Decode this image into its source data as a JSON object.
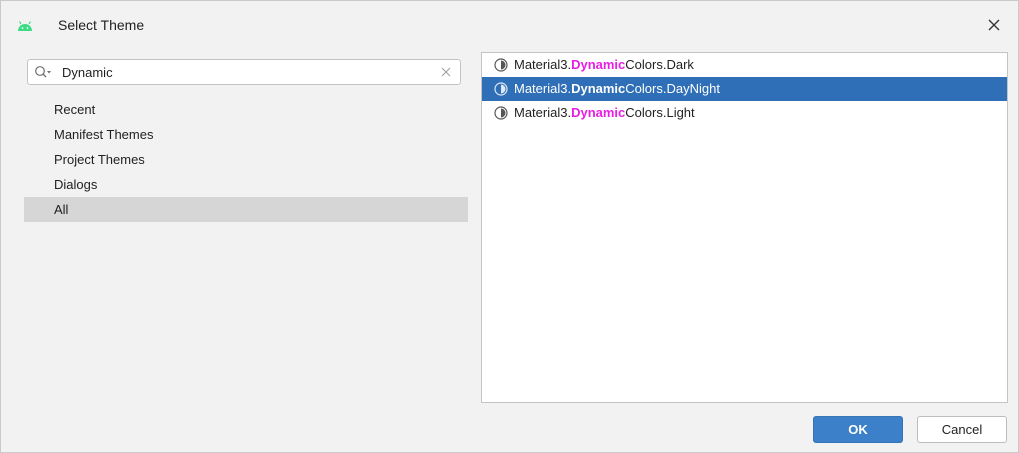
{
  "dialog": {
    "title": "Select Theme",
    "app_icon": "android-icon",
    "close_icon": "close-icon"
  },
  "search": {
    "value": "Dynamic",
    "icon": "search-icon",
    "clear_icon": "clear-icon"
  },
  "categories": [
    {
      "label": "Recent",
      "selected": false
    },
    {
      "label": "Manifest Themes",
      "selected": false
    },
    {
      "label": "Project Themes",
      "selected": false
    },
    {
      "label": "Dialogs",
      "selected": false
    },
    {
      "label": "All",
      "selected": true
    }
  ],
  "themes": [
    {
      "prefix": "Material3.",
      "match": "Dynamic",
      "suffix": "Colors.Dark",
      "selected": false
    },
    {
      "prefix": "Material3.",
      "match": "Dynamic",
      "suffix": "Colors.DayNight",
      "selected": true
    },
    {
      "prefix": "Material3.",
      "match": "Dynamic",
      "suffix": "Colors.Light",
      "selected": false
    }
  ],
  "buttons": {
    "ok_label": "OK",
    "cancel_label": "Cancel"
  },
  "colors": {
    "selection": "#2f6fb7",
    "match_highlight": "#e81ee5",
    "ok_button": "#3b80c8",
    "android_green": "#3ddc84"
  }
}
